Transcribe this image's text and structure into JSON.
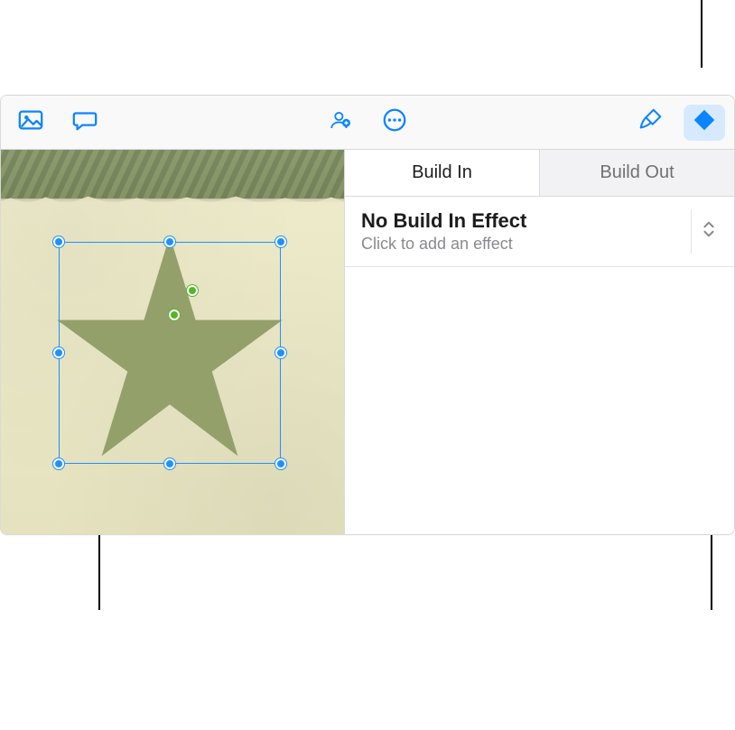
{
  "colors": {
    "accent": "#0a84ff",
    "star": "#94a06a",
    "handle": "#1e90ff"
  },
  "toolbar": {
    "icons": {
      "media": "media-icon",
      "comment": "comment-icon",
      "collaborate": "collaborate-icon",
      "more": "more-icon",
      "format": "format-brush-icon",
      "animate": "animate-icon"
    }
  },
  "tabs": {
    "build_in": "Build In",
    "build_out": "Build Out",
    "active": "build_in"
  },
  "effect": {
    "title": "No Build In Effect",
    "subtitle": "Click to add an effect"
  },
  "canvas": {
    "selected_object": "star-shape"
  }
}
